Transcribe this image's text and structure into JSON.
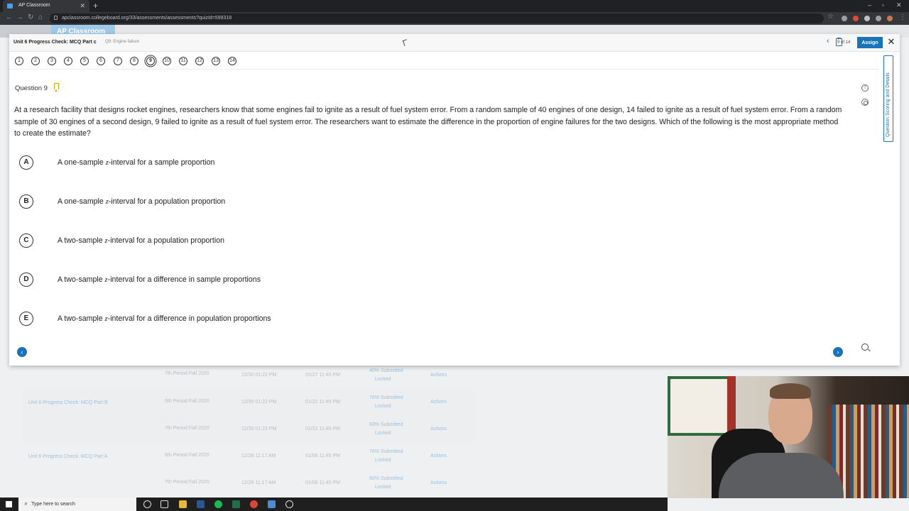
{
  "browser": {
    "tab_title": "AP Classroom",
    "url": "apclassroom.collegeboard.org/33/assessments/assessments?quizId=599318"
  },
  "background": {
    "brand": "AP Classroom",
    "rows": [
      {
        "assessment": "",
        "section": "7th Period Fall 2020",
        "start": "12/30 01:22 PM",
        "due": "01/27 11:45 PM",
        "submitted": "40% Submitted",
        "status": "Locked",
        "actions": "Actions"
      },
      {
        "assessment": "Unit 6 Progress Check: MCQ Part B",
        "section": "6th Period Fall 2020",
        "start": "12/30 01:22 PM",
        "due": "01/22 11:45 PM",
        "submitted": "76% Submitted",
        "status": "Locked",
        "actions": "Actions"
      },
      {
        "assessment": "",
        "section": "7th Period Fall 2020",
        "start": "12/30 01:22 PM",
        "due": "01/22 11:45 PM",
        "submitted": "63% Submitted",
        "status": "Locked",
        "actions": "Actions"
      },
      {
        "assessment": "Unit 6 Progress Check: MCQ Part A",
        "section": "6th Period Fall 2020",
        "start": "12/28 11:17 AM",
        "due": "01/08 11:45 PM",
        "submitted": "76% Submitted",
        "status": "Locked",
        "actions": "Actions"
      },
      {
        "assessment": "",
        "section": "7th Period Fall 2020",
        "start": "12/28 11:17 AM",
        "due": "01/08 11:45 PM",
        "submitted": "60% Submitted",
        "status": "Locked",
        "actions": "Actions"
      }
    ]
  },
  "modal": {
    "assessment_title": "Unit 6 Progress Check: MCQ Part c",
    "question_subtitle": "Q9: Engine failure",
    "assign_label": "Assign",
    "close_label": "✕",
    "question_numbers": [
      "1",
      "2",
      "3",
      "4",
      "5",
      "6",
      "7",
      "8",
      "9",
      "10",
      "11",
      "12",
      "13",
      "14"
    ],
    "active_question": "9",
    "position": "9 of 14",
    "side_tab_label": "Question Scoring and Details",
    "question_label": "Question 9",
    "stem": "At a research facility that designs rocket engines, researchers know that some engines fail to ignite as a result of fuel system error. From a random sample of 40 engines of one design, 14 failed to ignite as a result of fuel system error. From a random sample of 30 engines of a second design, 9 failed to ignite as a result of fuel system error. The researchers want to estimate the difference in the proportion of engine failures for the two designs. Which of the following is the most appropriate method to create the estimate?",
    "choices": [
      {
        "letter": "A",
        "pre": "A one-sample ",
        "var": "z",
        "post": "-interval for a sample proportion"
      },
      {
        "letter": "B",
        "pre": "A one-sample ",
        "var": "z",
        "post": "-interval for a population proportion"
      },
      {
        "letter": "C",
        "pre": "A two-sample ",
        "var": "z",
        "post": "-interval for a population proportion"
      },
      {
        "letter": "D",
        "pre": "A two-sample ",
        "var": "z",
        "post": "-interval for a difference in sample proportions"
      },
      {
        "letter": "E",
        "pre": "A two-sample ",
        "var": "z",
        "post": "-interval for a difference in population proportions"
      }
    ],
    "prev_label": "‹",
    "next_label": "›"
  },
  "taskbar": {
    "search_placeholder": "Type here to search"
  },
  "colors": {
    "accent": "#1a73b8",
    "bookmark": "#e0a400"
  },
  "icons": [
    "bookmark-icon",
    "help-icon",
    "gear-icon",
    "zoom-icon",
    "clipboard-icon",
    "close-icon",
    "chevron-left-icon",
    "chevron-right-icon"
  ]
}
